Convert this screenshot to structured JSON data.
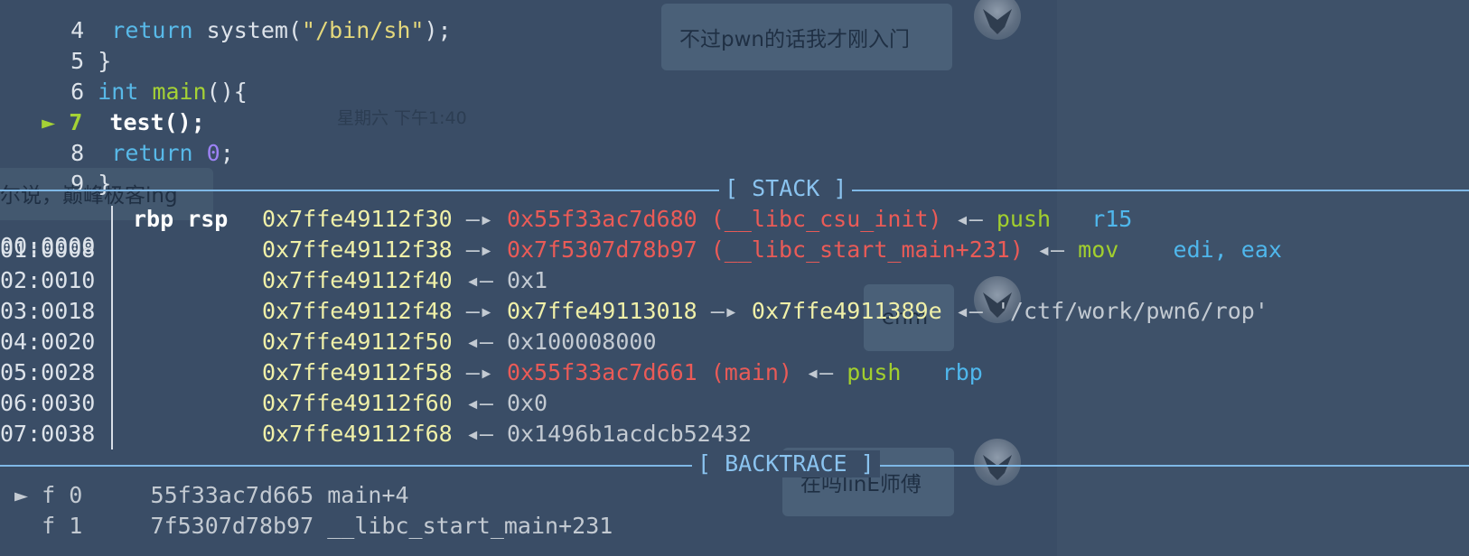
{
  "chat": {
    "bubble_1": "不过pwn的话我才刚入门",
    "timestamp": "星期六  下午1:40",
    "left_message": "尔说，巅峰极客ing",
    "bubble_2": "enm",
    "bubble_3": "在吗linE师傅"
  },
  "source": {
    "lines": [
      {
        "num": "4",
        "parts": [
          "return",
          " system(",
          "\"/bin/sh\"",
          ");"
        ]
      },
      {
        "num": "5",
        "text": "}"
      },
      {
        "num": "6",
        "kw": "int",
        "fn": "main",
        "rest": "(){"
      },
      {
        "num": "7",
        "marker": "►",
        "text": "test();"
      },
      {
        "num": "8",
        "kw": "return",
        "val": "0",
        "rest": ";"
      },
      {
        "num": "9",
        "text": "}"
      }
    ]
  },
  "stack": {
    "header": "[ STACK ]",
    "rows": [
      {
        "off": "00:0000",
        "reg": "rbp rsp",
        "addr": "0x7ffe49112f30",
        "arrow": "—▸",
        "target": "0x55f33ac7d680 (__libc_csu_init)",
        "target_color": "red",
        "back": "◂—",
        "ins": "push",
        "ops": "r15"
      },
      {
        "off": "01:0008",
        "reg": "",
        "addr": "0x7ffe49112f38",
        "arrow": "—▸",
        "target": "0x7f5307d78b97 (__libc_start_main+231)",
        "target_color": "red",
        "back": "◂—",
        "ins": "mov",
        "ops": "edi, eax"
      },
      {
        "off": "02:0010",
        "reg": "",
        "addr": "0x7ffe49112f40",
        "back": "◂—",
        "value": "0x1"
      },
      {
        "off": "03:0018",
        "reg": "",
        "addr": "0x7ffe49112f48",
        "arrow": "—▸",
        "target": "0x7ffe49113018",
        "target_color": "addr",
        "arrow2": "—▸",
        "target2": "0x7ffe4911389e",
        "back": "◂—",
        "value": "'/ctf/work/pwn6/rop'"
      },
      {
        "off": "04:0020",
        "reg": "",
        "addr": "0x7ffe49112f50",
        "back": "◂—",
        "value": "0x100008000"
      },
      {
        "off": "05:0028",
        "reg": "",
        "addr": "0x7ffe49112f58",
        "arrow": "—▸",
        "target": "0x55f33ac7d661 (main)",
        "target_color": "red",
        "back": "◂—",
        "ins": "push",
        "ops": "rbp"
      },
      {
        "off": "06:0030",
        "reg": "",
        "addr": "0x7ffe49112f60",
        "back": "◂—",
        "value": "0x0"
      },
      {
        "off": "07:0038",
        "reg": "",
        "addr": "0x7ffe49112f68",
        "back": "◂—",
        "value": "0x1496b1acdcb52432"
      }
    ]
  },
  "backtrace": {
    "header": "[ BACKTRACE ]",
    "frames": [
      {
        "marker": "►",
        "frame": "f 0",
        "addr": "55f33ac7d665",
        "sym": "main+4"
      },
      {
        "marker": "",
        "frame": "f 1",
        "addr": "7f5307d78b97",
        "sym": "__libc_start_main+231"
      }
    ]
  },
  "colors": {
    "background": "#3a4d66",
    "rule": "#7fb8e6",
    "address": "#f0f0a8",
    "pointer_red": "#ea5b57",
    "instruction_green": "#a2cf2e",
    "register_blue": "#4fb7ec"
  }
}
